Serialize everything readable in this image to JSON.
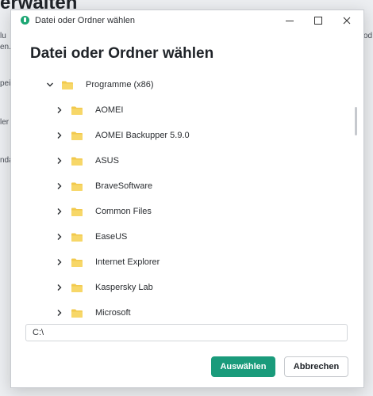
{
  "background": {
    "title_fragment": "erwalten",
    "left_fragments": [
      "lu",
      "en.",
      "pei",
      "ler",
      "nda"
    ],
    "right_fragments": [
      "od"
    ]
  },
  "dialog": {
    "window_title": "Datei oder Ordner wählen",
    "heading": "Datei oder Ordner wählen",
    "tree": {
      "root": {
        "label": "Programme (x86)",
        "expanded": true
      },
      "children": [
        "AOMEI",
        "AOMEI Backupper 5.9.0",
        "ASUS",
        "BraveSoftware",
        "Common Files",
        "EaseUS",
        "Internet Explorer",
        "Kaspersky Lab",
        "Microsoft"
      ]
    },
    "path_value": "C:\\",
    "buttons": {
      "ok_label": "Auswählen",
      "cancel_label": "Abbrechen"
    }
  },
  "colors": {
    "accent": "#1a9b7b",
    "folder": "#f2c94c"
  }
}
